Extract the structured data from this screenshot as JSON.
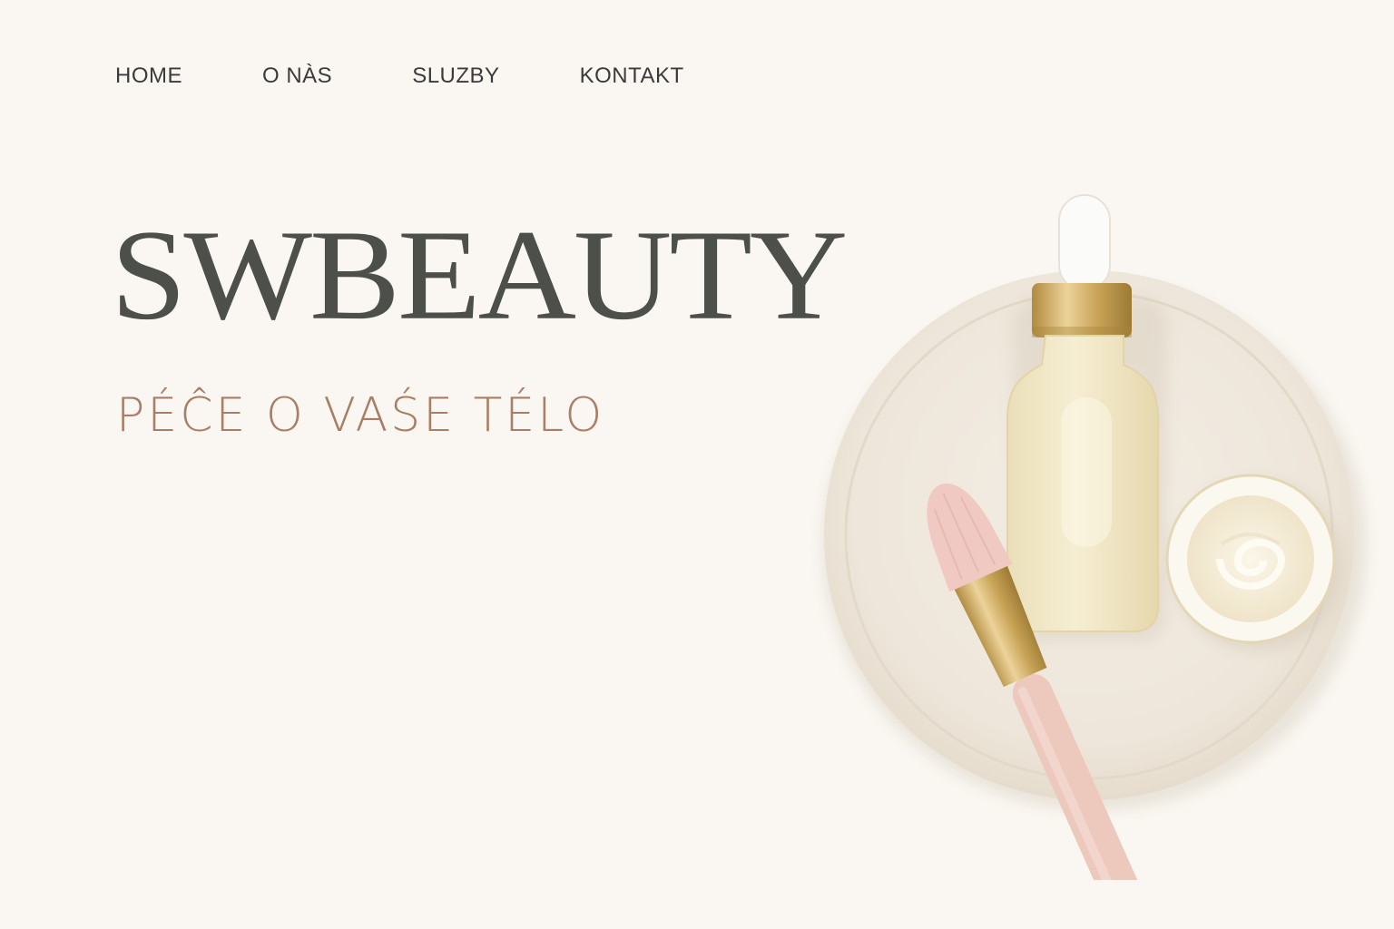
{
  "nav": {
    "items": [
      {
        "label": "HOME"
      },
      {
        "label": "O NÀS"
      },
      {
        "label": "SLUZBY"
      },
      {
        "label": "KONTAKT"
      }
    ]
  },
  "hero": {
    "brand": "SWBEAUTY",
    "tagline": "PÉĈE O VAŚE TÉLO"
  },
  "colors": {
    "background": "#faf7f2",
    "brand_text": "#4d4f4a",
    "tagline_text": "#a97d66",
    "gold": "#c9a458",
    "brush_pink": "#ecc8bd"
  },
  "image": {
    "name": "cosmetics-hero-image"
  }
}
